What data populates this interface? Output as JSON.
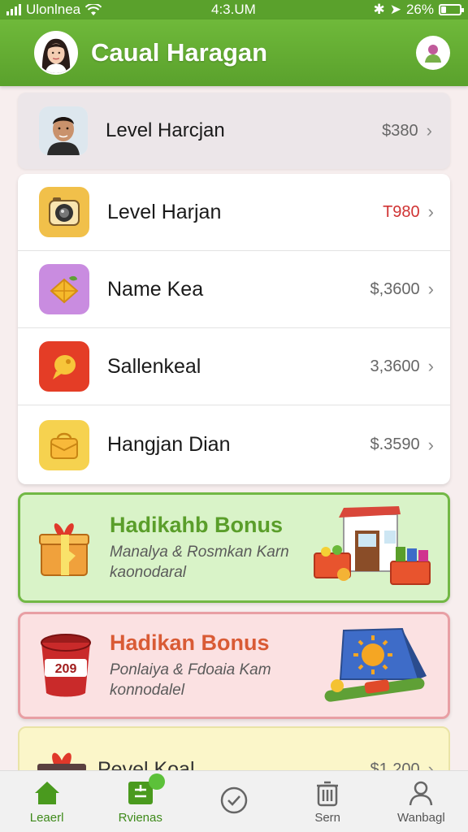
{
  "status_bar": {
    "carrier": "Ulonlnea",
    "time": "4:3.UM",
    "battery": "26%"
  },
  "header": {
    "title": "Caual Haragan"
  },
  "top_card": {
    "label": "Level Harcjan",
    "value": "$380"
  },
  "list": [
    {
      "label": "Level Harjan",
      "value": "T980",
      "icon": "camera-icon",
      "color": "#f1c04a"
    },
    {
      "label": "Name Kea",
      "value": "$,3600",
      "icon": "fruit-icon",
      "color": "#c98ce0"
    },
    {
      "label": "Sallenkeal",
      "value": "3,3600",
      "icon": "chat-icon",
      "color": "#e43d26"
    },
    {
      "label": "Hangjan Dian",
      "value": "$.3590",
      "icon": "bag-icon",
      "color": "#f6d24f"
    }
  ],
  "bonus_green": {
    "title": "Hadikahb Bonus",
    "line1": "Manalya & Rosmkan Karn",
    "line2": "kaonodaral"
  },
  "bonus_pink": {
    "title": "Hadikan Bonus",
    "line1": "Ponlaiya & Fdoaia Kam",
    "line2": "konnodalel",
    "badge": "209"
  },
  "bonus_yellow": {
    "title": "Pevel Koal",
    "value": "$1,200"
  },
  "nav": [
    {
      "label": "Leaerl",
      "icon": "home-icon"
    },
    {
      "label": "Rvienas",
      "icon": "grid-icon"
    },
    {
      "label": "",
      "icon": "check-circle-icon"
    },
    {
      "label": "Sern",
      "icon": "bin-icon"
    },
    {
      "label": "Wanbagl",
      "icon": "user-icon"
    }
  ],
  "colors": {
    "brand_green": "#5aa12c",
    "accent_red": "#d03333"
  }
}
